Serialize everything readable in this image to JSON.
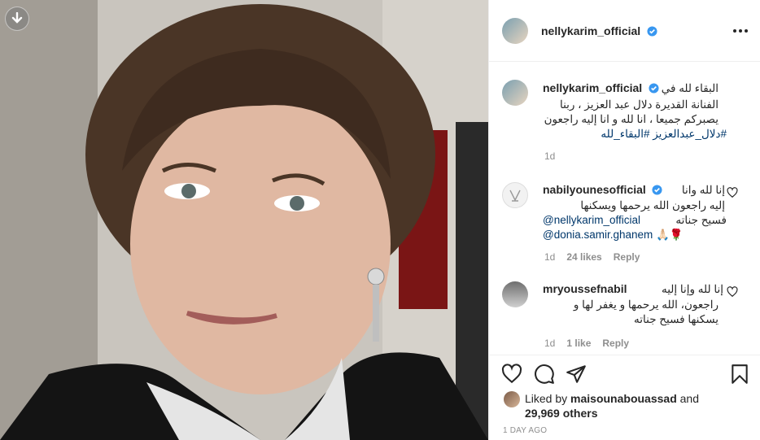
{
  "post": {
    "username": "nellykarim_official"
  },
  "caption": {
    "username": "nellykarim_official",
    "text_line1": "البقاء لله في",
    "text_line2": "الفنانة القديرة دلال عبد العزيز ، ربنا",
    "text_line3": "يصبركم جميعا ، انا لله و انا إليه راجعون",
    "hashtags": "#دلال_عبدالعزيز #البقاء_لله",
    "time": "1d"
  },
  "comments": [
    {
      "username": "nabilyounesofficial",
      "line1": "إنا لله وانا",
      "line2": "إليه راجعون الله يرحمها ويسكنها",
      "line3": "فسيح جناته",
      "mention1": "@nellykarim_official",
      "mention2": "@donia.samir.ghanem",
      "emojis": "🙏🏻🌹",
      "time": "1d",
      "likes": "24 likes",
      "reply": "Reply"
    },
    {
      "username": "mryoussefnabil",
      "line1": "إنا لله وإنا إليه",
      "line2": "راجعون، الله يرحمها و يغفر لها و",
      "line3": "يسكنها فسيح جناته",
      "time": "1d",
      "likes": "1 like",
      "reply": "Reply"
    }
  ],
  "likes": {
    "prefix": "Liked by",
    "user": "maisounabouassad",
    "and": "and",
    "count": "29,969 others"
  },
  "timestamp": "1 DAY AGO",
  "icons": [
    "download-icon",
    "more-options-icon",
    "verified-badge-icon",
    "heart-icon",
    "comment-icon",
    "share-icon",
    "save-icon"
  ],
  "colors": {
    "verified": "#3897f0",
    "link": "#00376b",
    "muted": "#8e8e8e"
  }
}
